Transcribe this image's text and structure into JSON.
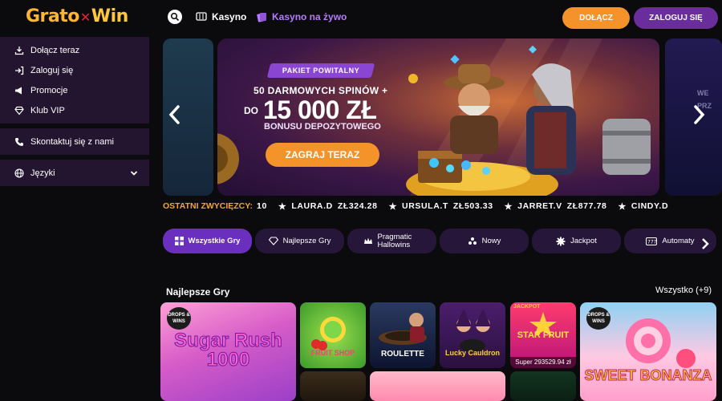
{
  "header": {
    "logo_left": "Grato",
    "logo_mid": "✕",
    "logo_right": "Win",
    "nav_casino": "Kasyno",
    "nav_live": "Kasyno na żywo",
    "join_label": "DOŁĄCZ",
    "login_label": "ZALOGUJ SIĘ"
  },
  "sidebar": {
    "items": [
      {
        "label": "Dołącz teraz",
        "icon": "join-icon"
      },
      {
        "label": "Zaloguj się",
        "icon": "login-icon"
      },
      {
        "label": "Promocje",
        "icon": "megaphone-icon"
      },
      {
        "label": "Klub VIP",
        "icon": "diamond-icon"
      }
    ],
    "contact_label": "Skontaktuj się z nami",
    "languages_label": "Języki"
  },
  "banner": {
    "pill": "PAKIET POWITALNY",
    "line1": "50 DARMOWYCH SPINÓW +",
    "line2_prefix": "DO",
    "line2_amount": "15 000 ZŁ",
    "line3": "BONUSU DEPOZYTOWEGO",
    "cta": "ZAGRAJ TERAZ",
    "right_ghost": "WE\nPRZ"
  },
  "ticker": {
    "title": "OSTATNI ZWYCIĘZCY:",
    "lead": "10",
    "winners": [
      {
        "name": "LAURA.D",
        "amount": "ZŁ324.28"
      },
      {
        "name": "URSULA.T",
        "amount": "ZŁ503.33"
      },
      {
        "name": "JARRET.V",
        "amount": "ZŁ877.78"
      },
      {
        "name": "CINDY.D",
        "amount": ""
      }
    ]
  },
  "categories": [
    {
      "label": "Wszystkie Gry",
      "icon": "grid-icon",
      "active": true
    },
    {
      "label": "Najlepsze Gry",
      "icon": "diamond-icon",
      "active": false
    },
    {
      "label": "Pragmatic Hallowins",
      "icon": "crown-icon",
      "active": false
    },
    {
      "label": "Nowy",
      "icon": "sparkle-icon",
      "active": false
    },
    {
      "label": "Jackpot",
      "icon": "gear-icon",
      "active": false
    },
    {
      "label": "Automaty",
      "icon": "slot-icon",
      "active": false
    }
  ],
  "section": {
    "title": "Najlepsze Gry",
    "see_all": "Wszystko (+9)"
  },
  "games": {
    "sugar": {
      "title": "Sugar Rush 1000",
      "badge": "DROPS & WINS"
    },
    "fruit": {
      "title": "FRUIT SHOP"
    },
    "roulette": {
      "title": "ROULETTE"
    },
    "cauldron": {
      "title": "Lucky Cauldron"
    },
    "star": {
      "title": "STAR FRUIT",
      "jackpot": "JACKPOT",
      "jackpot_value": "Super 293529.94 zł"
    },
    "sweet": {
      "title": "SWEET BONANZA",
      "badge": "DROPS & WINS"
    }
  },
  "colors": {
    "accent_orange": "#f5922a",
    "accent_purple": "#6a2d9c",
    "live_purple": "#b77bff",
    "ticker_gold": "#f2a531"
  }
}
